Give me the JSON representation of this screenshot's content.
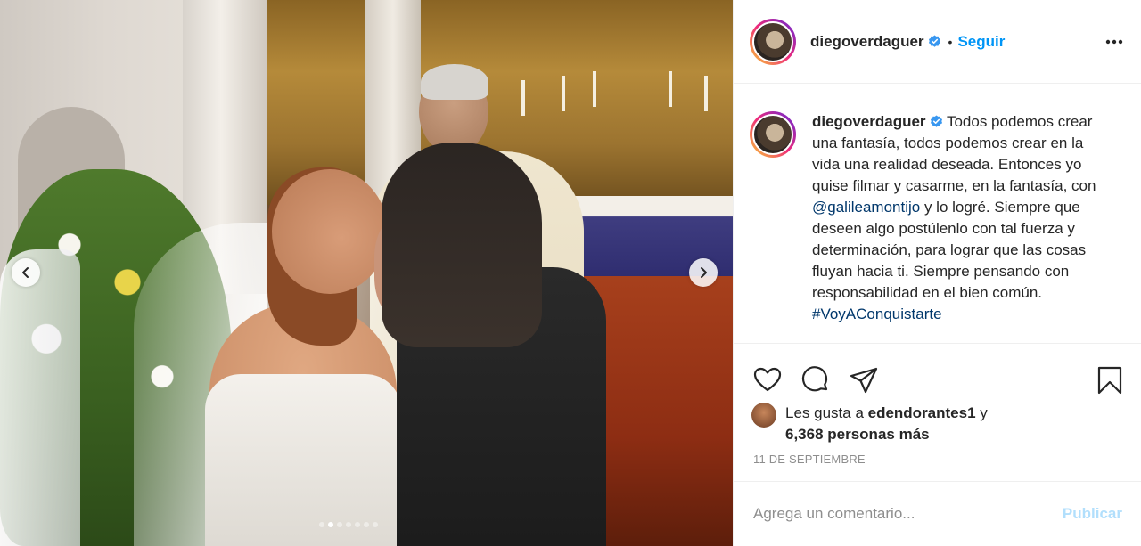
{
  "post": {
    "username": "diegoverdaguer",
    "separator": "•",
    "follow_label": "Seguir",
    "verified_icon": "verified-badge-icon",
    "more_icon": "more-options-icon"
  },
  "caption": {
    "username": "diegoverdaguer",
    "text_part1": "Todos podemos crear una fantasía, todos podemos crear en la vida una realidad deseada. Entonces yo quise filmar y casarme, en la fantasía, con ",
    "mention": "@galileamontijo",
    "text_part2": " y lo logré. Siempre que deseen algo postúlenlo con tal fuerza y determinación, para lograr que las cosas fluyan hacia ti. Siempre pensando con responsabilidad en el bien común. ",
    "hashtag": "#VoyAConquistarte"
  },
  "actions": {
    "like_icon": "heart-icon",
    "comment_icon": "comment-icon",
    "share_icon": "share-icon",
    "save_icon": "bookmark-icon"
  },
  "likes": {
    "prefix": "Les gusta a ",
    "first_user": "edendorantes1",
    "joiner": " y",
    "count_text": "6,368 personas más"
  },
  "date": "11 DE SEPTIEMBRE",
  "comment": {
    "placeholder": "Agrega un comentario...",
    "publish_label": "Publicar"
  },
  "carousel": {
    "total_slides": 7,
    "active_index": 1
  },
  "colors": {
    "link_blue": "#0095f6",
    "mention_blue": "#00376b",
    "muted": "#8e8e8e",
    "publish_disabled": "#b2dffc"
  }
}
